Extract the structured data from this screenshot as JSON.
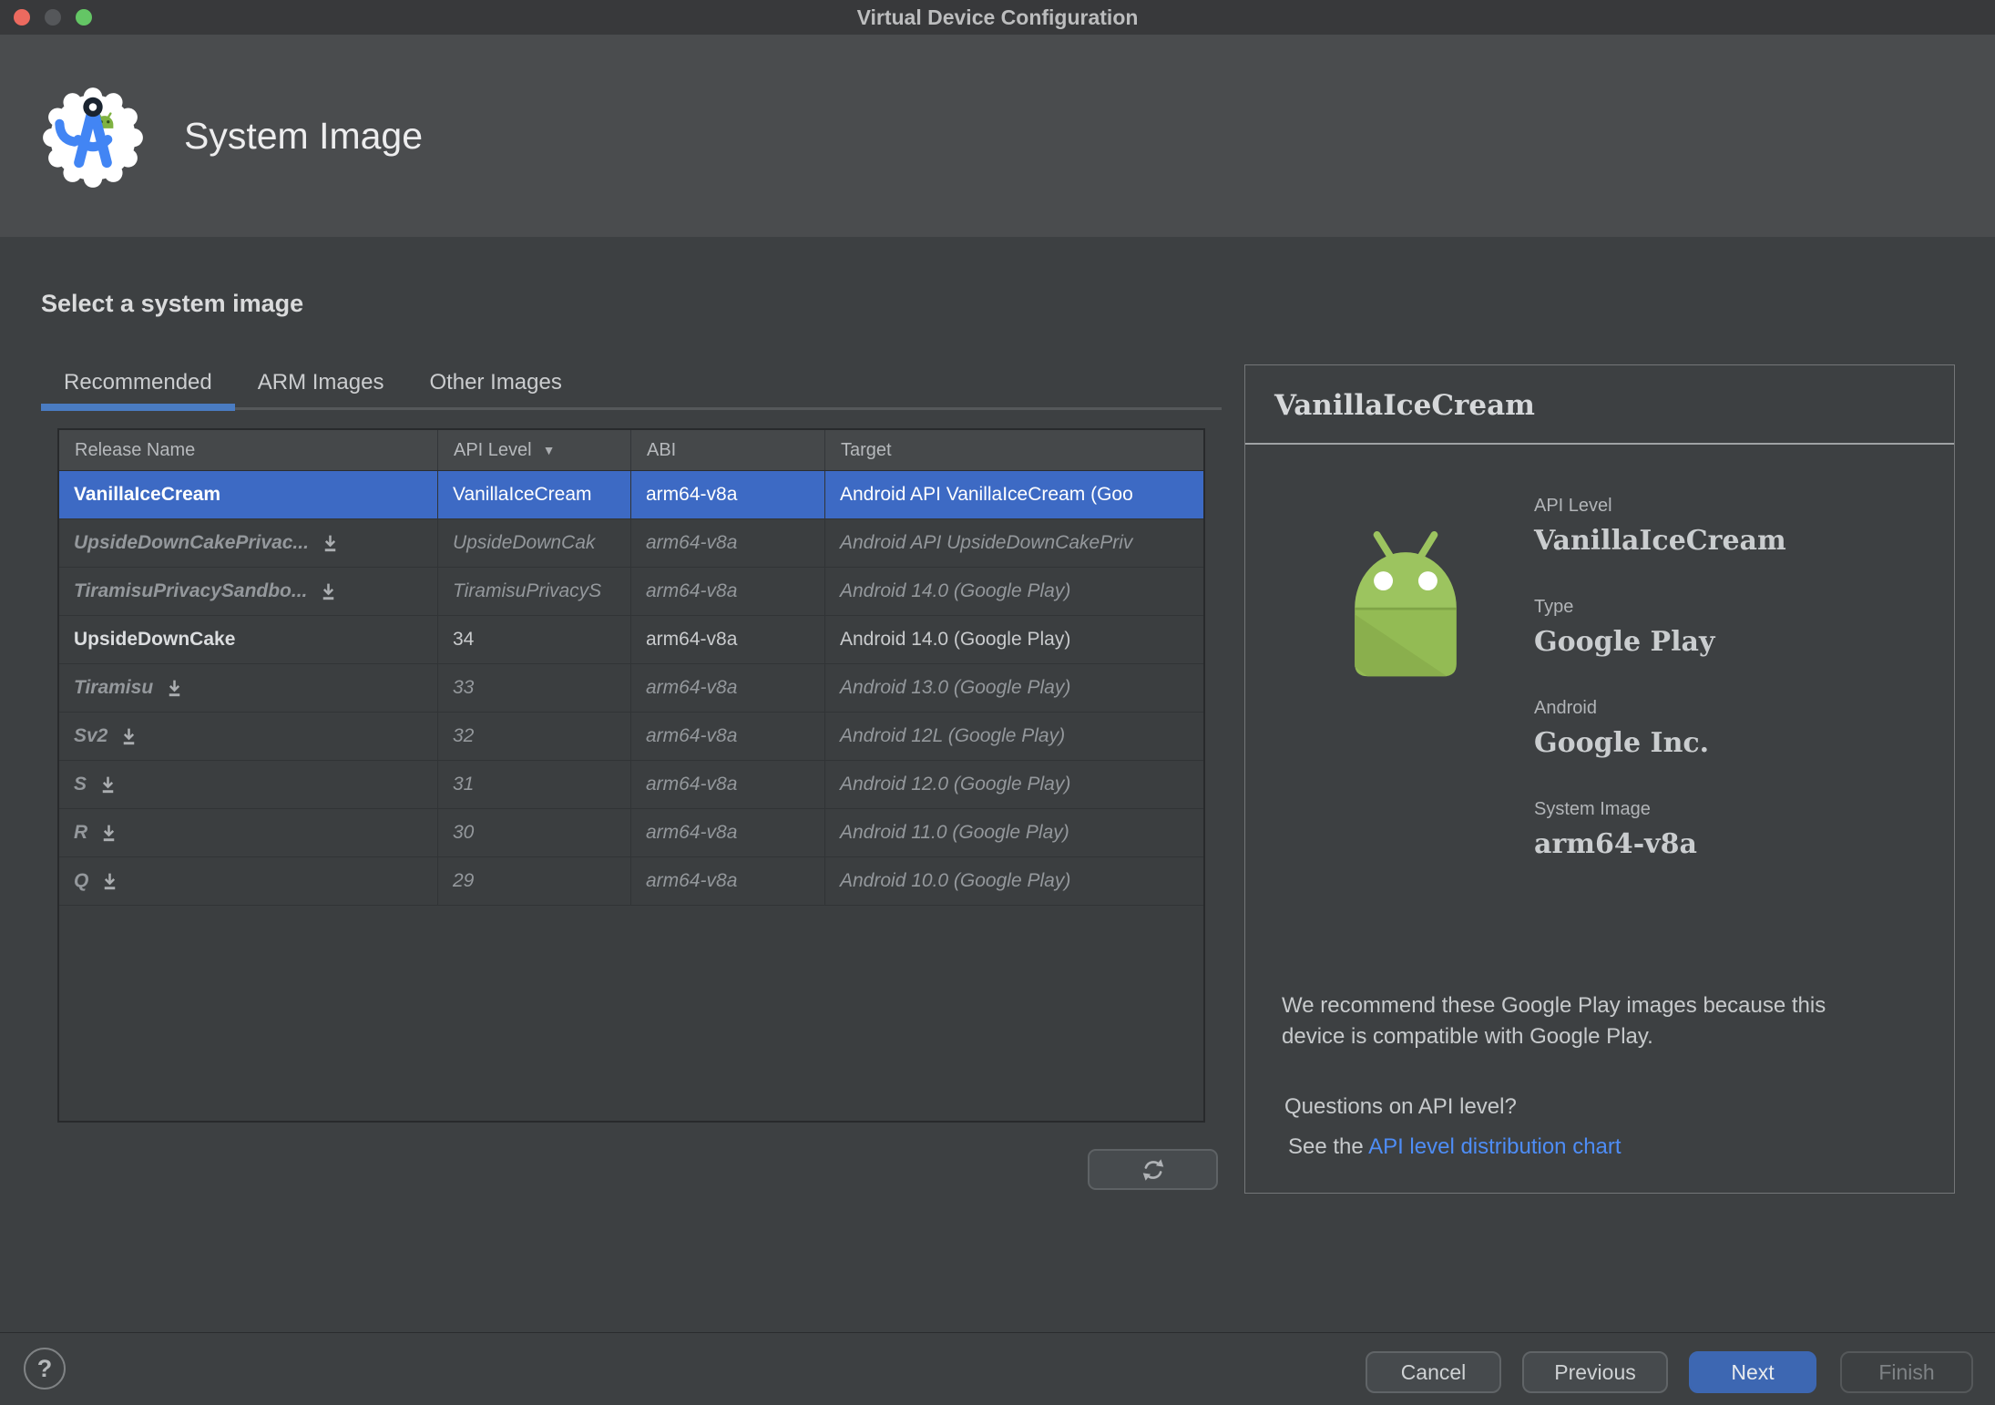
{
  "window": {
    "title": "Virtual Device Configuration"
  },
  "header": {
    "title": "System Image"
  },
  "section_title": "Select a system image",
  "tabs": [
    {
      "label": "Recommended",
      "active": true
    },
    {
      "label": "ARM Images",
      "active": false
    },
    {
      "label": "Other Images",
      "active": false
    }
  ],
  "table": {
    "columns": [
      "Release Name",
      "API Level",
      "ABI",
      "Target"
    ],
    "sort_column": "API Level",
    "rows": [
      {
        "name": "VanillaIceCream",
        "api": "VanillaIceCream",
        "abi": "arm64-v8a",
        "target": "Android API VanillaIceCream (Goo",
        "state": "selected",
        "download": false
      },
      {
        "name": "UpsideDownCakePrivac...",
        "api": "UpsideDownCak",
        "abi": "arm64-v8a",
        "target": "Android API UpsideDownCakePriv",
        "state": "remote",
        "download": true
      },
      {
        "name": "TiramisuPrivacySandbo...",
        "api": "TiramisuPrivacyS",
        "abi": "arm64-v8a",
        "target": "Android 14.0 (Google Play)",
        "state": "remote",
        "download": true
      },
      {
        "name": "UpsideDownCake",
        "api": "34",
        "abi": "arm64-v8a",
        "target": "Android 14.0 (Google Play)",
        "state": "installed",
        "download": false
      },
      {
        "name": "Tiramisu",
        "api": "33",
        "abi": "arm64-v8a",
        "target": "Android 13.0 (Google Play)",
        "state": "remote",
        "download": true
      },
      {
        "name": "Sv2",
        "api": "32",
        "abi": "arm64-v8a",
        "target": "Android 12L (Google Play)",
        "state": "remote",
        "download": true
      },
      {
        "name": "S",
        "api": "31",
        "abi": "arm64-v8a",
        "target": "Android 12.0 (Google Play)",
        "state": "remote",
        "download": true
      },
      {
        "name": "R",
        "api": "30",
        "abi": "arm64-v8a",
        "target": "Android 11.0 (Google Play)",
        "state": "remote",
        "download": true
      },
      {
        "name": "Q",
        "api": "29",
        "abi": "arm64-v8a",
        "target": "Android 10.0 (Google Play)",
        "state": "remote",
        "download": true
      }
    ]
  },
  "details": {
    "title": "VanillaIceCream",
    "fields": [
      {
        "label": "API Level",
        "value": "VanillaIceCream"
      },
      {
        "label": "Type",
        "value": "Google Play"
      },
      {
        "label": "Android",
        "value": "Google Inc."
      },
      {
        "label": "System Image",
        "value": "arm64-v8a"
      }
    ],
    "recommendation": "We recommend these Google Play images because this device is compatible with Google Play.",
    "question": "Questions on API level?",
    "see_the": "See the ",
    "link": "API level distribution chart"
  },
  "buttons": {
    "cancel": "Cancel",
    "previous": "Previous",
    "next": "Next",
    "finish": "Finish"
  },
  "help_glyph": "?",
  "icons": [
    "android-studio-logo",
    "download-icon",
    "sort-descending-icon",
    "refresh-icon",
    "android-robot-icon",
    "question-mark-icon"
  ],
  "colors": {
    "selection_blue": "#3D6AC4",
    "tab_underline": "#4A7CC2",
    "primary_button": "#3D67B2",
    "link_blue": "#4E8DF6",
    "robot_green": "#9CC45F"
  }
}
